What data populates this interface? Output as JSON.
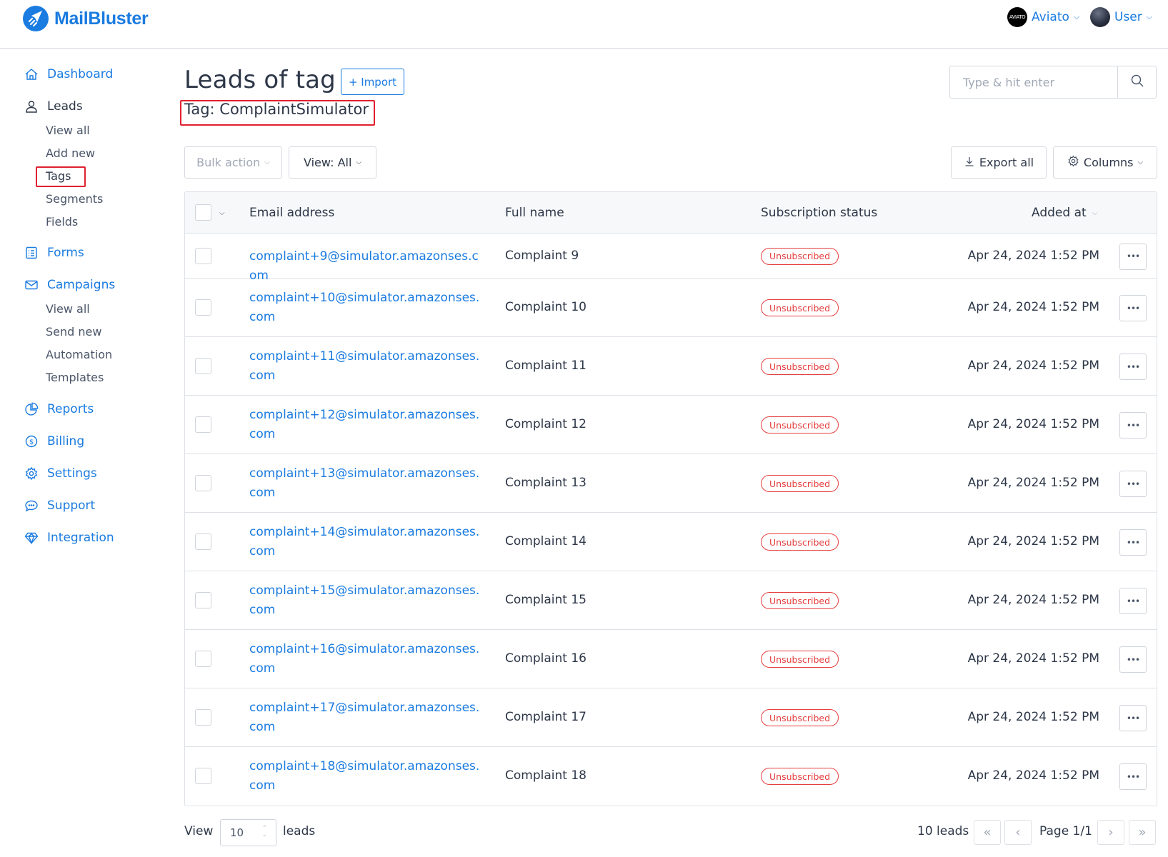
{
  "app": {
    "brand": "MailBluster",
    "brand_color": "#1a7be0"
  },
  "header": {
    "accounts": [
      {
        "name": "Aviato",
        "avatar_text": "AVIATO",
        "icon": "chevron-down-icon"
      },
      {
        "name": "User",
        "icon": "chevron-down-icon"
      }
    ]
  },
  "sidebar": {
    "dashboard": {
      "label": "Dashboard",
      "icon": "home-icon"
    },
    "leads": {
      "label": "Leads",
      "icon": "user-icon",
      "children": [
        "View all",
        "Add new",
        "Tags",
        "Segments",
        "Fields"
      ],
      "active_child": "Tags"
    },
    "forms": {
      "label": "Forms",
      "icon": "form-list-icon"
    },
    "campaigns": {
      "label": "Campaigns",
      "icon": "envelope-icon",
      "children": [
        "View all",
        "Send new",
        "Automation",
        "Templates"
      ]
    },
    "reports": {
      "label": "Reports",
      "icon": "pie-chart-icon"
    },
    "billing": {
      "label": "Billing",
      "icon": "dollar-circle-icon"
    },
    "settings": {
      "label": "Settings",
      "icon": "gear-icon"
    },
    "support": {
      "label": "Support",
      "icon": "chat-bubble-icon"
    },
    "integration": {
      "label": "Integration",
      "icon": "diamond-icon"
    }
  },
  "main": {
    "title": "Leads of tag",
    "import_label": "+ Import",
    "tag_label": "Tag: ComplaintSimulator",
    "search": {
      "placeholder": "Type & hit enter",
      "value": ""
    },
    "toolbar": {
      "bulk_action": "Bulk action",
      "view": "View: All",
      "export": "Export all",
      "columns": "Columns"
    },
    "table": {
      "columns": [
        "Email address",
        "Full name",
        "Subscription status",
        "Added at"
      ],
      "rows": [
        {
          "email": "complaint+9@simulator.amazonses.com",
          "name": "Complaint 9",
          "status": "Unsubscribed",
          "added": "Apr 24, 2024 1:52 PM"
        },
        {
          "email": "complaint+10@simulator.amazonses.com",
          "name": "Complaint 10",
          "status": "Unsubscribed",
          "added": "Apr 24, 2024 1:52 PM"
        },
        {
          "email": "complaint+11@simulator.amazonses.com",
          "name": "Complaint 11",
          "status": "Unsubscribed",
          "added": "Apr 24, 2024 1:52 PM"
        },
        {
          "email": "complaint+12@simulator.amazonses.com",
          "name": "Complaint 12",
          "status": "Unsubscribed",
          "added": "Apr 24, 2024 1:52 PM"
        },
        {
          "email": "complaint+13@simulator.amazonses.com",
          "name": "Complaint 13",
          "status": "Unsubscribed",
          "added": "Apr 24, 2024 1:52 PM"
        },
        {
          "email": "complaint+14@simulator.amazonses.com",
          "name": "Complaint 14",
          "status": "Unsubscribed",
          "added": "Apr 24, 2024 1:52 PM"
        },
        {
          "email": "complaint+15@simulator.amazonses.com",
          "name": "Complaint 15",
          "status": "Unsubscribed",
          "added": "Apr 24, 2024 1:52 PM"
        },
        {
          "email": "complaint+16@simulator.amazonses.com",
          "name": "Complaint 16",
          "status": "Unsubscribed",
          "added": "Apr 24, 2024 1:52 PM"
        },
        {
          "email": "complaint+17@simulator.amazonses.com",
          "name": "Complaint 17",
          "status": "Unsubscribed",
          "added": "Apr 24, 2024 1:52 PM"
        },
        {
          "email": "complaint+18@simulator.amazonses.com",
          "name": "Complaint 18",
          "status": "Unsubscribed",
          "added": "Apr 24, 2024 1:52 PM"
        }
      ],
      "status_color": "#e53e3e"
    },
    "footer": {
      "view_label": "View",
      "per_page": "10",
      "leads_label": "leads",
      "total": "10 leads",
      "page": "Page 1/1"
    }
  }
}
